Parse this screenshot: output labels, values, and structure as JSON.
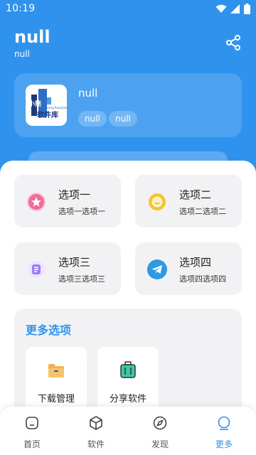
{
  "status_bar": {
    "time": "10:19"
  },
  "header": {
    "title": "null",
    "subtitle": "null",
    "share_icon": "share-icon"
  },
  "app_card": {
    "name": "null",
    "tags": [
      "null",
      "null"
    ],
    "logo": {
      "text_top": "小熊",
      "text_bottom": "软件库",
      "text_small": "Xiaoxiong Ruanjianku"
    }
  },
  "options": [
    {
      "title": "选项一",
      "subtitle": "选项一选项一",
      "icon": "star-icon",
      "color": "#f06a9a"
    },
    {
      "title": "选项二",
      "subtitle": "选项二选项二",
      "icon": "smile-icon",
      "color": "#f5c430"
    },
    {
      "title": "选项三",
      "subtitle": "选项三选项三",
      "icon": "document-icon",
      "color": "#9b7cf2"
    },
    {
      "title": "选项四",
      "subtitle": "选项四选项四",
      "icon": "telegram-icon",
      "color": "#2d9ae2"
    }
  ],
  "more": {
    "title": "更多选项",
    "tools": [
      {
        "label": "下载管理",
        "icon": "folder-icon"
      },
      {
        "label": "分享软件",
        "icon": "briefcase-icon"
      }
    ]
  },
  "tabbar": {
    "tabs": [
      {
        "label": "首页",
        "icon": "home-icon"
      },
      {
        "label": "软件",
        "icon": "box-icon"
      },
      {
        "label": "发现",
        "icon": "compass-icon"
      },
      {
        "label": "更多",
        "icon": "more-icon",
        "active": true
      }
    ]
  },
  "colors": {
    "accent": "#2f93ee",
    "card_bg": "#f2f2f4"
  }
}
